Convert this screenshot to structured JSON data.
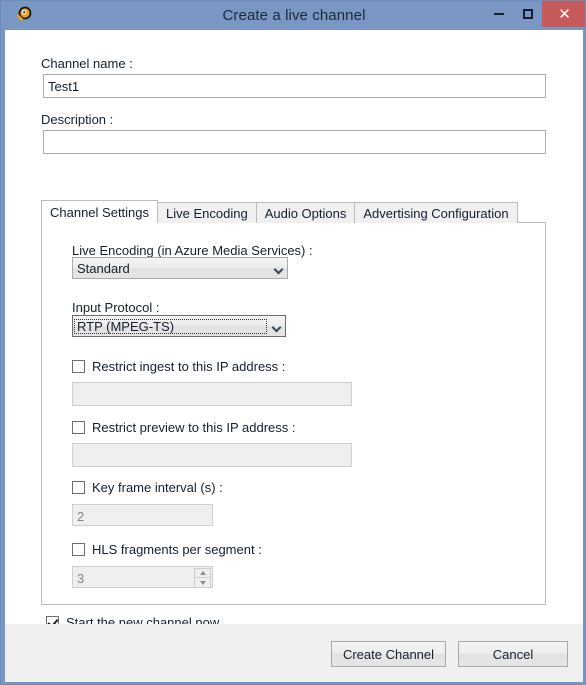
{
  "window": {
    "title": "Create a live channel",
    "icon": "app-logo-icon",
    "controls": {
      "minimize": "minimize-icon",
      "maximize": "maximize-icon",
      "close": "✕"
    },
    "colors": {
      "titlebar": "#7a96c2",
      "close_button": "#c75b5b",
      "footer": "#f0f0f0",
      "text": "#14202f"
    }
  },
  "form": {
    "channel_name_label": "Channel name :",
    "channel_name_value": "Test1",
    "channel_name_placeholder": "",
    "description_label": "Description :",
    "description_value": "",
    "description_placeholder": ""
  },
  "tabs": [
    {
      "label": "Channel Settings",
      "active": true
    },
    {
      "label": "Live Encoding",
      "active": false
    },
    {
      "label": "Audio Options",
      "active": false
    },
    {
      "label": "Advertising Configuration",
      "active": false
    }
  ],
  "channel_settings": {
    "live_encoding_label": "Live Encoding (in Azure Media Services) :",
    "live_encoding_value": "Standard",
    "input_protocol_label": "Input Protocol :",
    "input_protocol_value": "RTP (MPEG-TS)",
    "restrict_ingest": {
      "label": "Restrict ingest to this IP address :",
      "checked": false,
      "value": "",
      "enabled": false
    },
    "restrict_preview": {
      "label": "Restrict preview to this IP address :",
      "checked": false,
      "value": "",
      "enabled": false
    },
    "key_frame_interval": {
      "label": "Key frame interval (s) :",
      "checked": false,
      "value": "2",
      "enabled": false
    },
    "hls_fragments": {
      "label": "HLS fragments per segment :",
      "checked": false,
      "value": "3",
      "enabled": false
    }
  },
  "start_channel": {
    "label": "Start the new channel now",
    "checked": true
  },
  "footer": {
    "create_label": "Create Channel",
    "cancel_label": "Cancel"
  }
}
